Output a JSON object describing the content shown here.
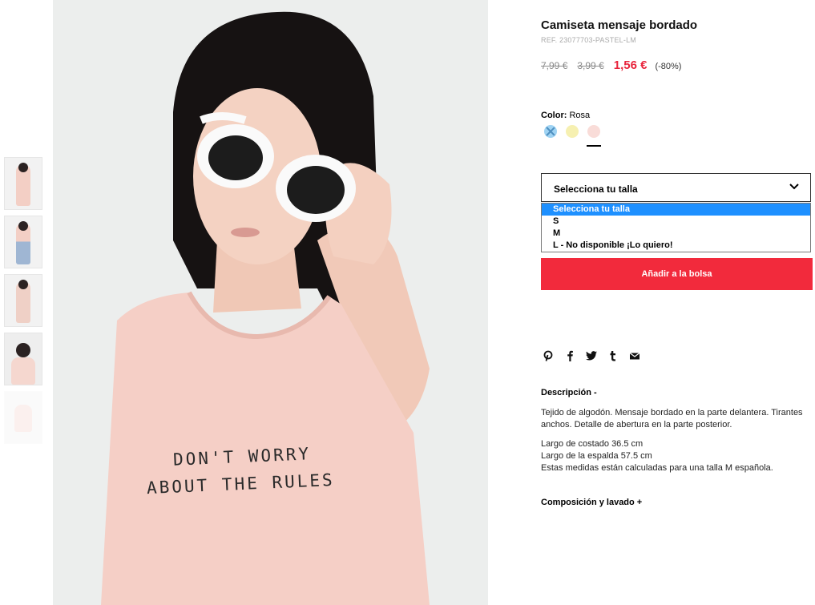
{
  "product": {
    "title": "Camiseta mensaje bordado",
    "ref": "REF. 23077703-PASTEL-LM",
    "price_original": "7,99 €",
    "price_previous": "3,99 €",
    "price_current": "1,56 €",
    "discount": "(-80%)"
  },
  "image": {
    "shirt_line1": "DON'T WORRY",
    "shirt_line2": "ABOUT THE RULES"
  },
  "color": {
    "label": "Color:",
    "value": "Rosa",
    "swatches": [
      {
        "name": "blue",
        "color": "#9fd3f3",
        "available": false
      },
      {
        "name": "yellow",
        "color": "#f6f0b1",
        "available": true
      },
      {
        "name": "pink",
        "color": "#f9dcd8",
        "available": true,
        "selected": true
      }
    ]
  },
  "size": {
    "selected": "Selecciona tu talla",
    "options": [
      "Selecciona tu talla",
      "S",
      "M",
      "L - No disponible ¡Lo quiero!"
    ]
  },
  "add_button": "Añadir a la bolsa",
  "share_icons": [
    "pinterest-icon",
    "facebook-icon",
    "twitter-icon",
    "tumblr-icon",
    "email-icon"
  ],
  "description": {
    "heading": "Descripción -",
    "p1": "Tejido de algodón. Mensaje bordado en la parte delantera. Tirantes anchos. Detalle de abertura en la parte posterior.",
    "m1": "Largo de costado 36.5 cm",
    "m2": "Largo de la espalda 57.5 cm",
    "m3": "Estas medidas están calculadas para una talla M española."
  },
  "composition_heading": "Composición y lavado +"
}
